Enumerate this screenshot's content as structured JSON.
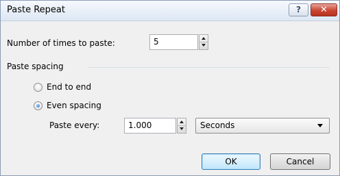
{
  "window": {
    "title": "Paste Repeat",
    "help_glyph": "?",
    "close_glyph": "✕"
  },
  "fields": {
    "times_label": "Number of times to paste:",
    "times_value": "5",
    "spacing_group_label": "Paste spacing",
    "end_to_end_label": "End to end",
    "end_to_end_selected": false,
    "even_spacing_label": "Even spacing",
    "even_spacing_selected": true,
    "paste_every_label": "Paste every:",
    "paste_every_value": "1.000",
    "unit_selected": "Seconds"
  },
  "buttons": {
    "ok_label": "OK",
    "cancel_label": "Cancel"
  },
  "icons": {
    "help": "help-icon",
    "close": "close-icon",
    "spin_up": "spin-up-icon",
    "spin_down": "spin-down-icon",
    "dropdown": "chevron-down-icon"
  },
  "colors": {
    "dialog_bg": "#f0f0f0",
    "close_button": "#c94531",
    "radio_selected": "#1c63c2",
    "default_button_border": "#3c7fb1"
  }
}
